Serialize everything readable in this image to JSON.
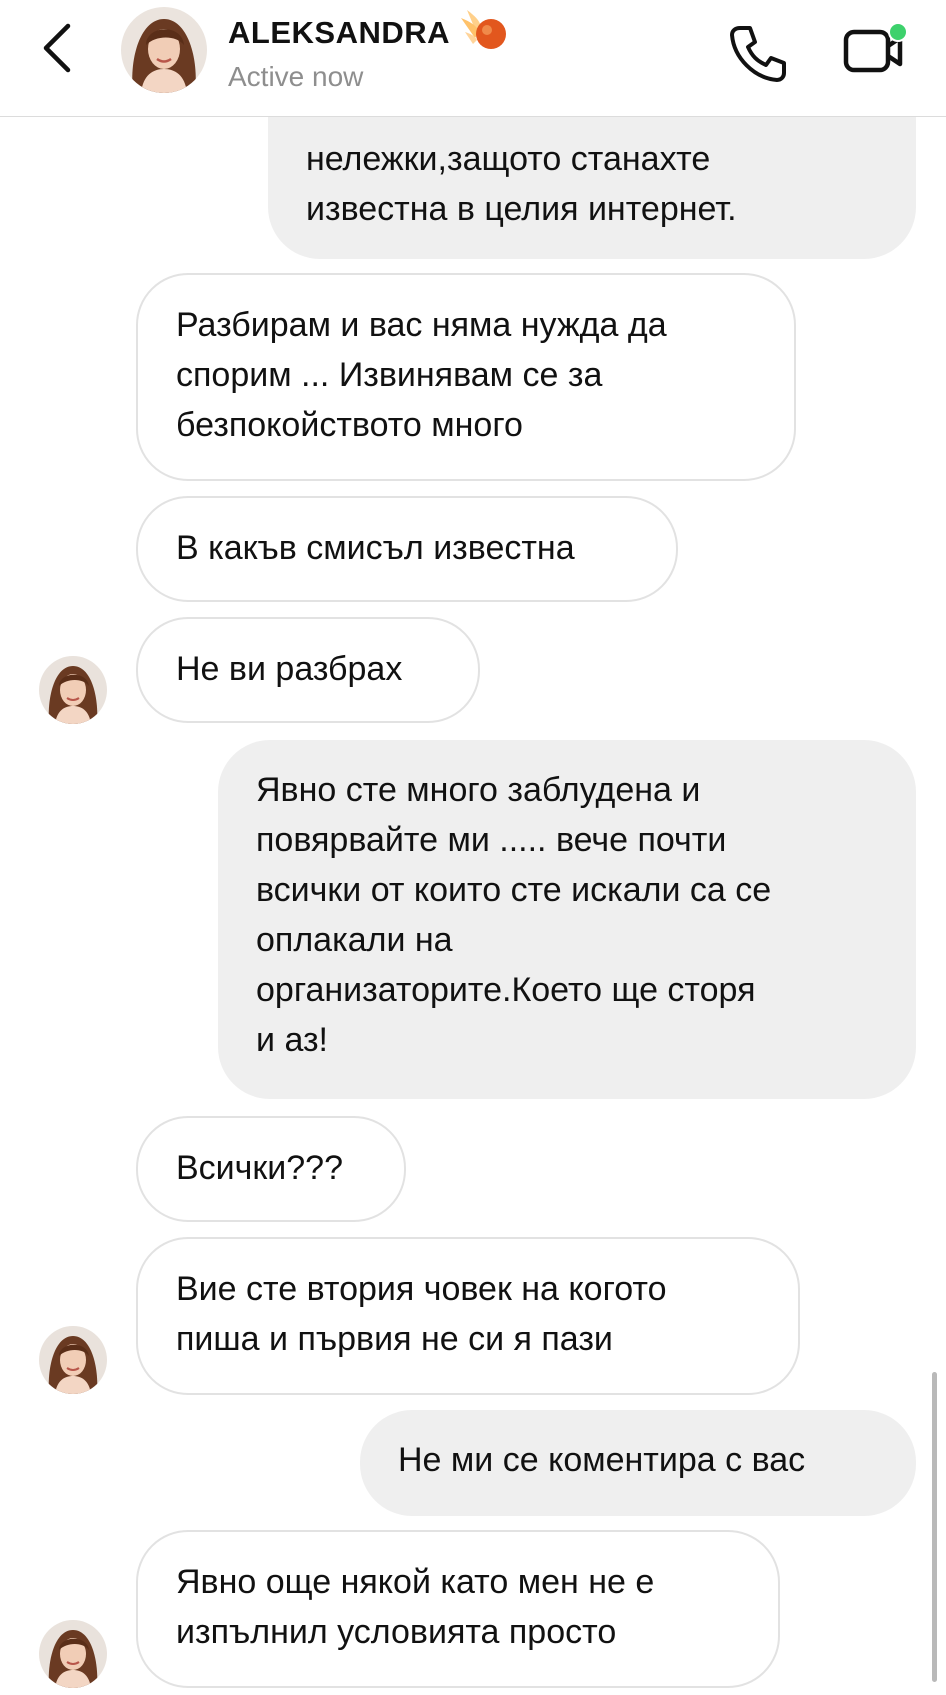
{
  "header": {
    "contact_name": "ALEKSANDRA",
    "status": "Active now",
    "status_indicator_color": "#3dd16c"
  },
  "messages": [
    {
      "direction": "outgoing",
      "lines": [
        "нележки,защото станахте",
        "известна в целия интернет."
      ]
    },
    {
      "direction": "incoming",
      "lines": [
        "Разбирам и вас няма нужда да",
        "спорим ... Извинявам се за",
        "безпокойството много"
      ]
    },
    {
      "direction": "incoming",
      "lines": [
        "В какъв смисъл известна"
      ]
    },
    {
      "direction": "incoming",
      "lines": [
        "Не ви разбрах"
      ],
      "avatar": true
    },
    {
      "direction": "outgoing",
      "lines": [
        "Явно сте много заблудена и",
        "повярвайте ми ..... вече почти",
        "всички от които сте искали са се",
        "оплакали на",
        "организаторите.Което ще сторя",
        "и аз!"
      ]
    },
    {
      "direction": "incoming",
      "lines": [
        "Всички???"
      ]
    },
    {
      "direction": "incoming",
      "lines": [
        "Вие сте втория човек на когото",
        "пиша и първия не си я пази"
      ],
      "avatar": true
    },
    {
      "direction": "outgoing",
      "lines": [
        "Не ми се коментира с вас"
      ]
    },
    {
      "direction": "incoming",
      "lines": [
        "Явно още някой като мен не е",
        "изпълнил условията просто"
      ],
      "avatar": true
    }
  ],
  "icons": {
    "back": "chevron-left-icon",
    "call": "phone-icon",
    "video": "video-camera-icon",
    "emoji": "fire-emoji"
  },
  "colors": {
    "incoming_bubble_border": "#e2e2e2",
    "outgoing_bubble_bg": "#efefef",
    "secondary_text": "#8e8e8e"
  }
}
